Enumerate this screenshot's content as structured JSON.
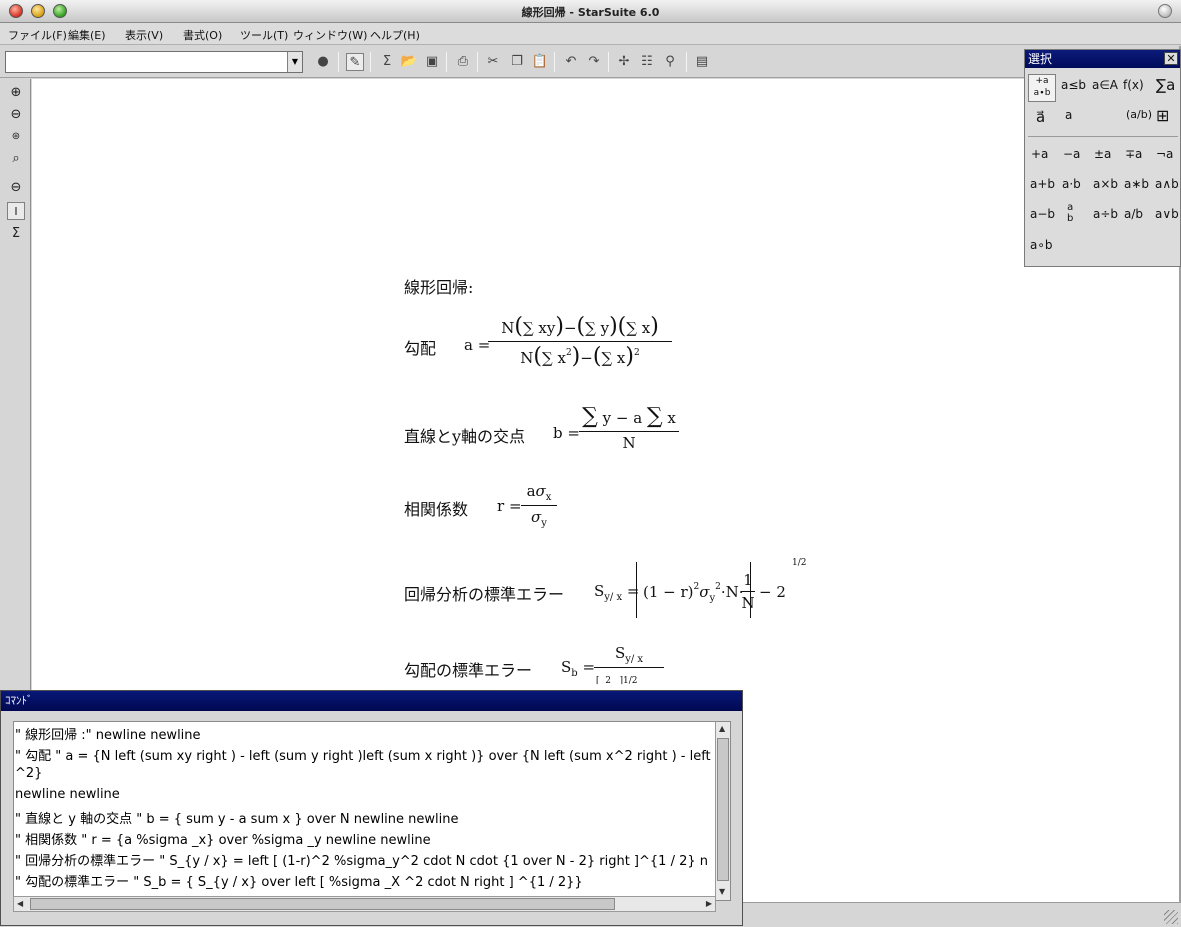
{
  "window": {
    "title": "線形回帰 - StarSuite 6.0"
  },
  "menu": [
    "ファイル(F)",
    "編集(E)",
    "表示(V)",
    "書式(O)",
    "ツール(T)",
    "ウィンドウ(W)",
    "ヘルプ(H)"
  ],
  "toolbar": {
    "combo_value": "",
    "icons": [
      "record-icon",
      "edit-icon",
      "formula-icon",
      "open-icon",
      "save-icon",
      "print-icon",
      "cut-icon",
      "copy-icon",
      "paste-icon",
      "undo-icon",
      "redo-icon",
      "navigate-icon",
      "catalog-icon",
      "symbols-icon",
      "gallery-icon"
    ]
  },
  "lefttools": [
    "zoom-in-icon",
    "zoom-out-icon",
    "zoom-100-icon",
    "zoom-fit-icon",
    "zoom-prev-icon",
    "formula-cursor-icon",
    "sigma-icon"
  ],
  "formulas": {
    "heading": "線形回帰:",
    "slope_label": "勾配",
    "intercept_label": "直線とy軸の交点",
    "correlation_label": "相関係数",
    "std_error_label": "回帰分析の標準エラー",
    "slope_error_label": "勾配の標準エラー"
  },
  "palette": {
    "title": "選択",
    "symbols": [
      "a≤b",
      "a∈A",
      "f(x)",
      "∑a",
      "a⃗",
      "a",
      "(a/b)",
      "+a",
      "−a",
      "±a",
      "∓a",
      "¬a",
      "a+b",
      "a·b",
      "a×b",
      "a∗b",
      "a∧b",
      "a−b",
      "a/b",
      "a÷b",
      "a/b",
      "a∨b",
      "a∘b"
    ]
  },
  "command": {
    "title": "ｺﾏﾝﾄﾞ",
    "lines": [
      "\" 線形回帰 :\" newline newline",
      "\" 勾配    \" a = {N left (sum xy right ) - left (sum y right )left (sum x right )} over {N left (sum x^2 right ) - left",
      "^2}",
      "newline newline",
      "\" 直線と y 軸の交点    \" b = { sum y - a sum x } over N newline newline",
      "\" 相関係数    \" r = {a %sigma _x} over %sigma _y newline newline",
      "\" 回帰分析の標準エラー    \" S_{y / x} = left [ (1-r)^2 %sigma_y^2 cdot N cdot {1 over N - 2} right ]^{1 / 2} n",
      "\" 勾配の標準エラー    \" S_b = { S_{y / x} over left [ %sigma _X ^2 cdot N right ] ^{1 / 2}}"
    ]
  }
}
